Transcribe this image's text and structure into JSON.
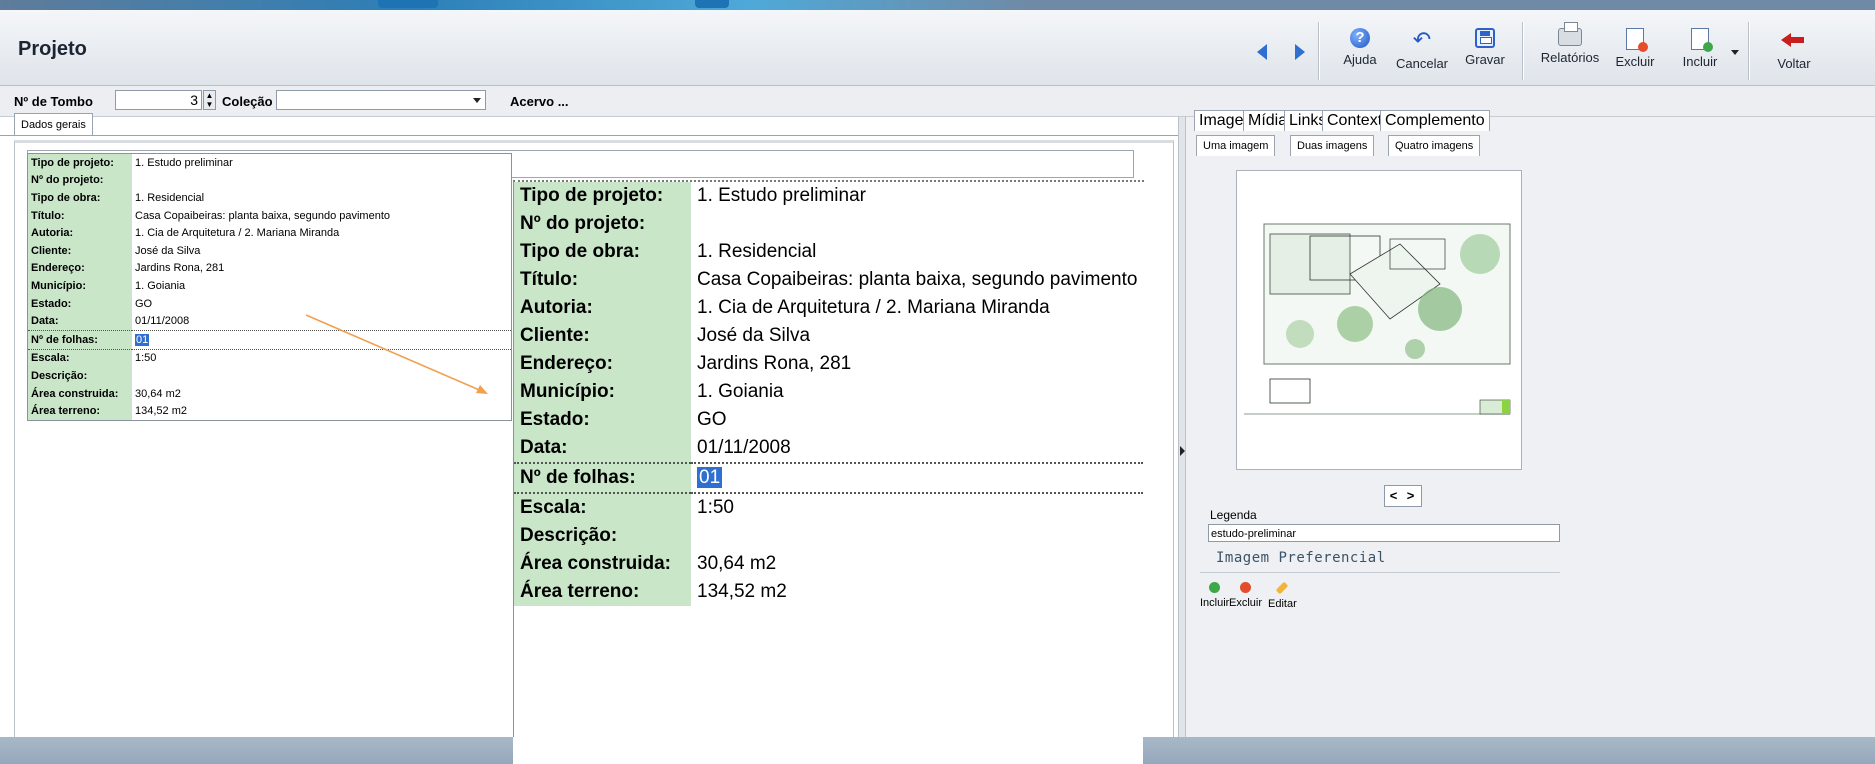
{
  "header": {
    "title": "Projeto",
    "buttons": {
      "ajuda": "Ajuda",
      "cancelar": "Cancelar",
      "gravar": "Gravar",
      "relatorios": "Relatórios",
      "excluir": "Excluir",
      "incluir": "Incluir",
      "voltar": "Voltar"
    }
  },
  "filter": {
    "tombo_label": "Nº de Tombo",
    "tombo_value": "3",
    "colecao_label": "Coleção",
    "colecao_value": "",
    "acervo_label": "Acervo ..."
  },
  "left": {
    "tab": "Dados gerais"
  },
  "record": [
    {
      "key": "Tipo de projeto:",
      "value": "1. Estudo preliminar"
    },
    {
      "key": "Nº do projeto:",
      "value": ""
    },
    {
      "key": "Tipo de obra:",
      "value": "1. Residencial"
    },
    {
      "key": "Título:",
      "value": "Casa Copaibeiras: planta baixa, segundo pavimento"
    },
    {
      "key": "Autoria:",
      "value": "1. Cia de Arquitetura / 2. Mariana Miranda"
    },
    {
      "key": "Cliente:",
      "value": "José da Silva"
    },
    {
      "key": "Endereço:",
      "value": "Jardins Rona, 281"
    },
    {
      "key": "Município:",
      "value": "1. Goiania"
    },
    {
      "key": "Estado:",
      "value": "GO"
    },
    {
      "key": "Data:",
      "value": "01/11/2008"
    },
    {
      "key": "Nº de folhas:",
      "value": "01"
    },
    {
      "key": "Escala:",
      "value": "1:50"
    },
    {
      "key": "Descrição:",
      "value": ""
    },
    {
      "key": "Área construida:",
      "value": "30,64 m2"
    },
    {
      "key": "Área terreno:",
      "value": "134,52 m2"
    }
  ],
  "right": {
    "tabs": [
      "Imagens",
      "Mídias",
      "Links",
      "Contexto",
      "Complemento"
    ],
    "subtabs": [
      "Uma imagem",
      "Duas imagens",
      "Quatro imagens"
    ],
    "nav_prev": "<",
    "nav_next": ">",
    "legenda_label": "Legenda",
    "legenda_value": "estudo-preliminar",
    "imagem_preferencial": "Imagem Preferencial",
    "actions": {
      "incluir": "Incluir",
      "excluir": "Excluir",
      "editar": "Editar"
    }
  },
  "colors": {
    "label_bg": "#c9e6c9",
    "selection": "#2f6fd1",
    "annotation_arrow": "#f0a050"
  },
  "icons": [
    "help-icon",
    "undo-icon",
    "save-icon",
    "print-icon",
    "delete-doc-icon",
    "add-doc-icon",
    "back-arrow-icon",
    "nav-prev-icon",
    "nav-next-icon"
  ]
}
